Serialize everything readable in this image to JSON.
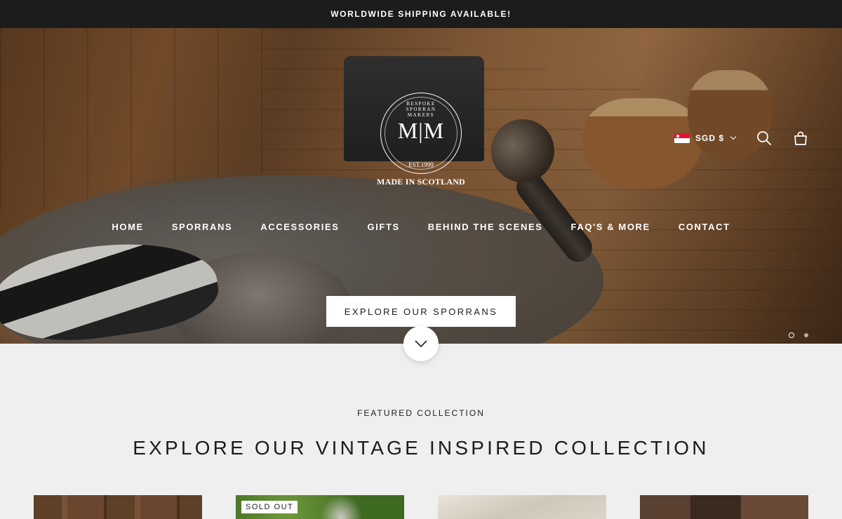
{
  "announcement": "WORLDWIDE SHIPPING AVAILABLE!",
  "logo": {
    "monogram": "M|M",
    "arc_text": "BESPOKE SPORRAN MAKERS",
    "established": "EST.1999",
    "tagline": "MADE IN SCOTLAND"
  },
  "header": {
    "currency": "SGD $",
    "currency_flag": "singapore-flag-icon"
  },
  "nav": {
    "items": [
      {
        "label": "HOME"
      },
      {
        "label": "SPORRANS"
      },
      {
        "label": "ACCESSORIES"
      },
      {
        "label": "GIFTS"
      },
      {
        "label": "BEHIND THE SCENES"
      },
      {
        "label": "FAQ'S & MORE"
      },
      {
        "label": "CONTACT"
      }
    ]
  },
  "hero": {
    "cta": "EXPLORE OUR SPORRANS",
    "slides_count": 2,
    "active_slide": 1
  },
  "featured": {
    "subheading": "FEATURED COLLECTION",
    "heading": "EXPLORE OUR VINTAGE INSPIRED COLLECTION",
    "products": [
      {
        "badge": ""
      },
      {
        "badge": "SOLD OUT"
      },
      {
        "badge": ""
      },
      {
        "badge": ""
      }
    ]
  },
  "colors": {
    "announcement_bg": "#1c1c1c",
    "page_bg": "#efefef",
    "text": "#1c1c1c"
  }
}
